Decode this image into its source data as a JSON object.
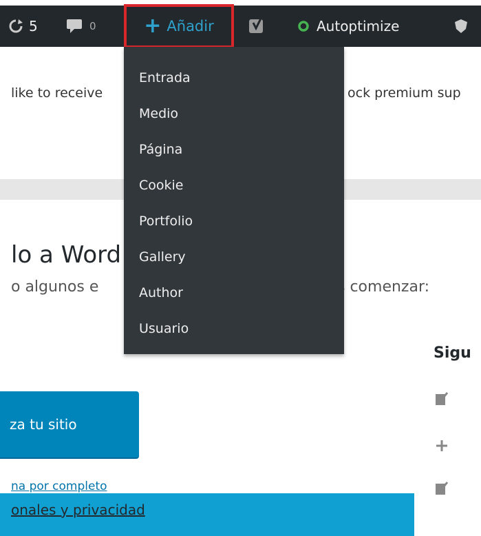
{
  "adminbar": {
    "updates_count": "5",
    "comments_count": "0",
    "add_label": "Añadir",
    "autoptimize_label": "Autoptimize"
  },
  "add_menu": {
    "items": [
      "Entrada",
      "Medio",
      "Página",
      "Cookie",
      "Portfolio",
      "Gallery",
      "Author",
      "Usuario"
    ]
  },
  "notice": {
    "text_left": "like to receive",
    "text_right": "ock premium sup"
  },
  "welcome": {
    "title": "lo a Word",
    "subtitle": "o algunos e",
    "subtitle_right": "s comenzar:",
    "customize_button": "za tu sitio",
    "complete_link": "na por completo",
    "banner_link": "onales y privacidad",
    "next_steps_title": "Sigu"
  },
  "colors": {
    "adminbar_bg": "#23282d",
    "dropdown_bg": "#32373c",
    "highlight_border": "#d9262a",
    "primary_button": "#0085ba",
    "banner": "#11a0d2"
  }
}
